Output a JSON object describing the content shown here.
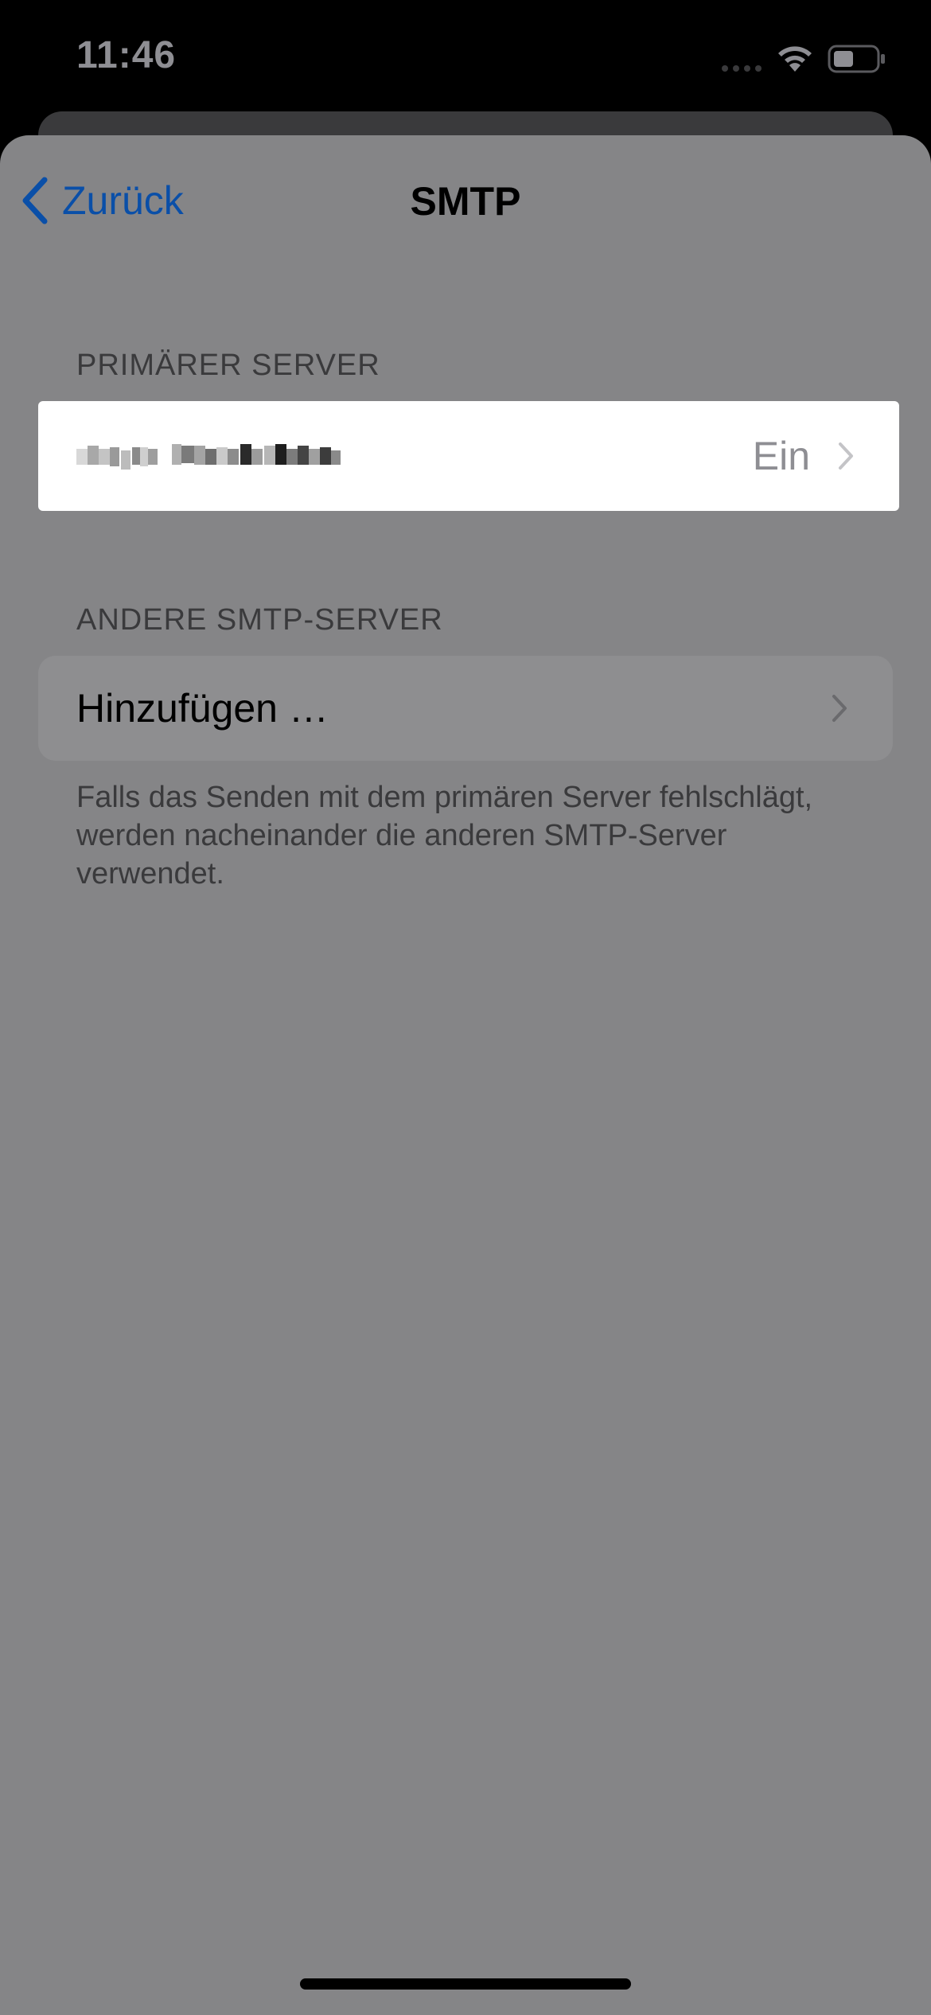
{
  "status_bar": {
    "time": "11:46"
  },
  "nav": {
    "back_label": "Zurück",
    "title": "SMTP"
  },
  "primary_section": {
    "header": "PRIMÄRER SERVER",
    "server": {
      "name_icon": "pixelated-server-name",
      "value": "Ein"
    }
  },
  "other_section": {
    "header": "ANDERE SMTP-SERVER",
    "add_label": "Hinzufügen …",
    "footer": "Falls das Senden mit dem primären Server fehlschlägt, werden nacheinander die anderen SMTP-Server verwendet."
  },
  "colors": {
    "accent": "#0a4fa8",
    "sheet_background": "#858587",
    "highlight_cell": "#ffffff"
  }
}
